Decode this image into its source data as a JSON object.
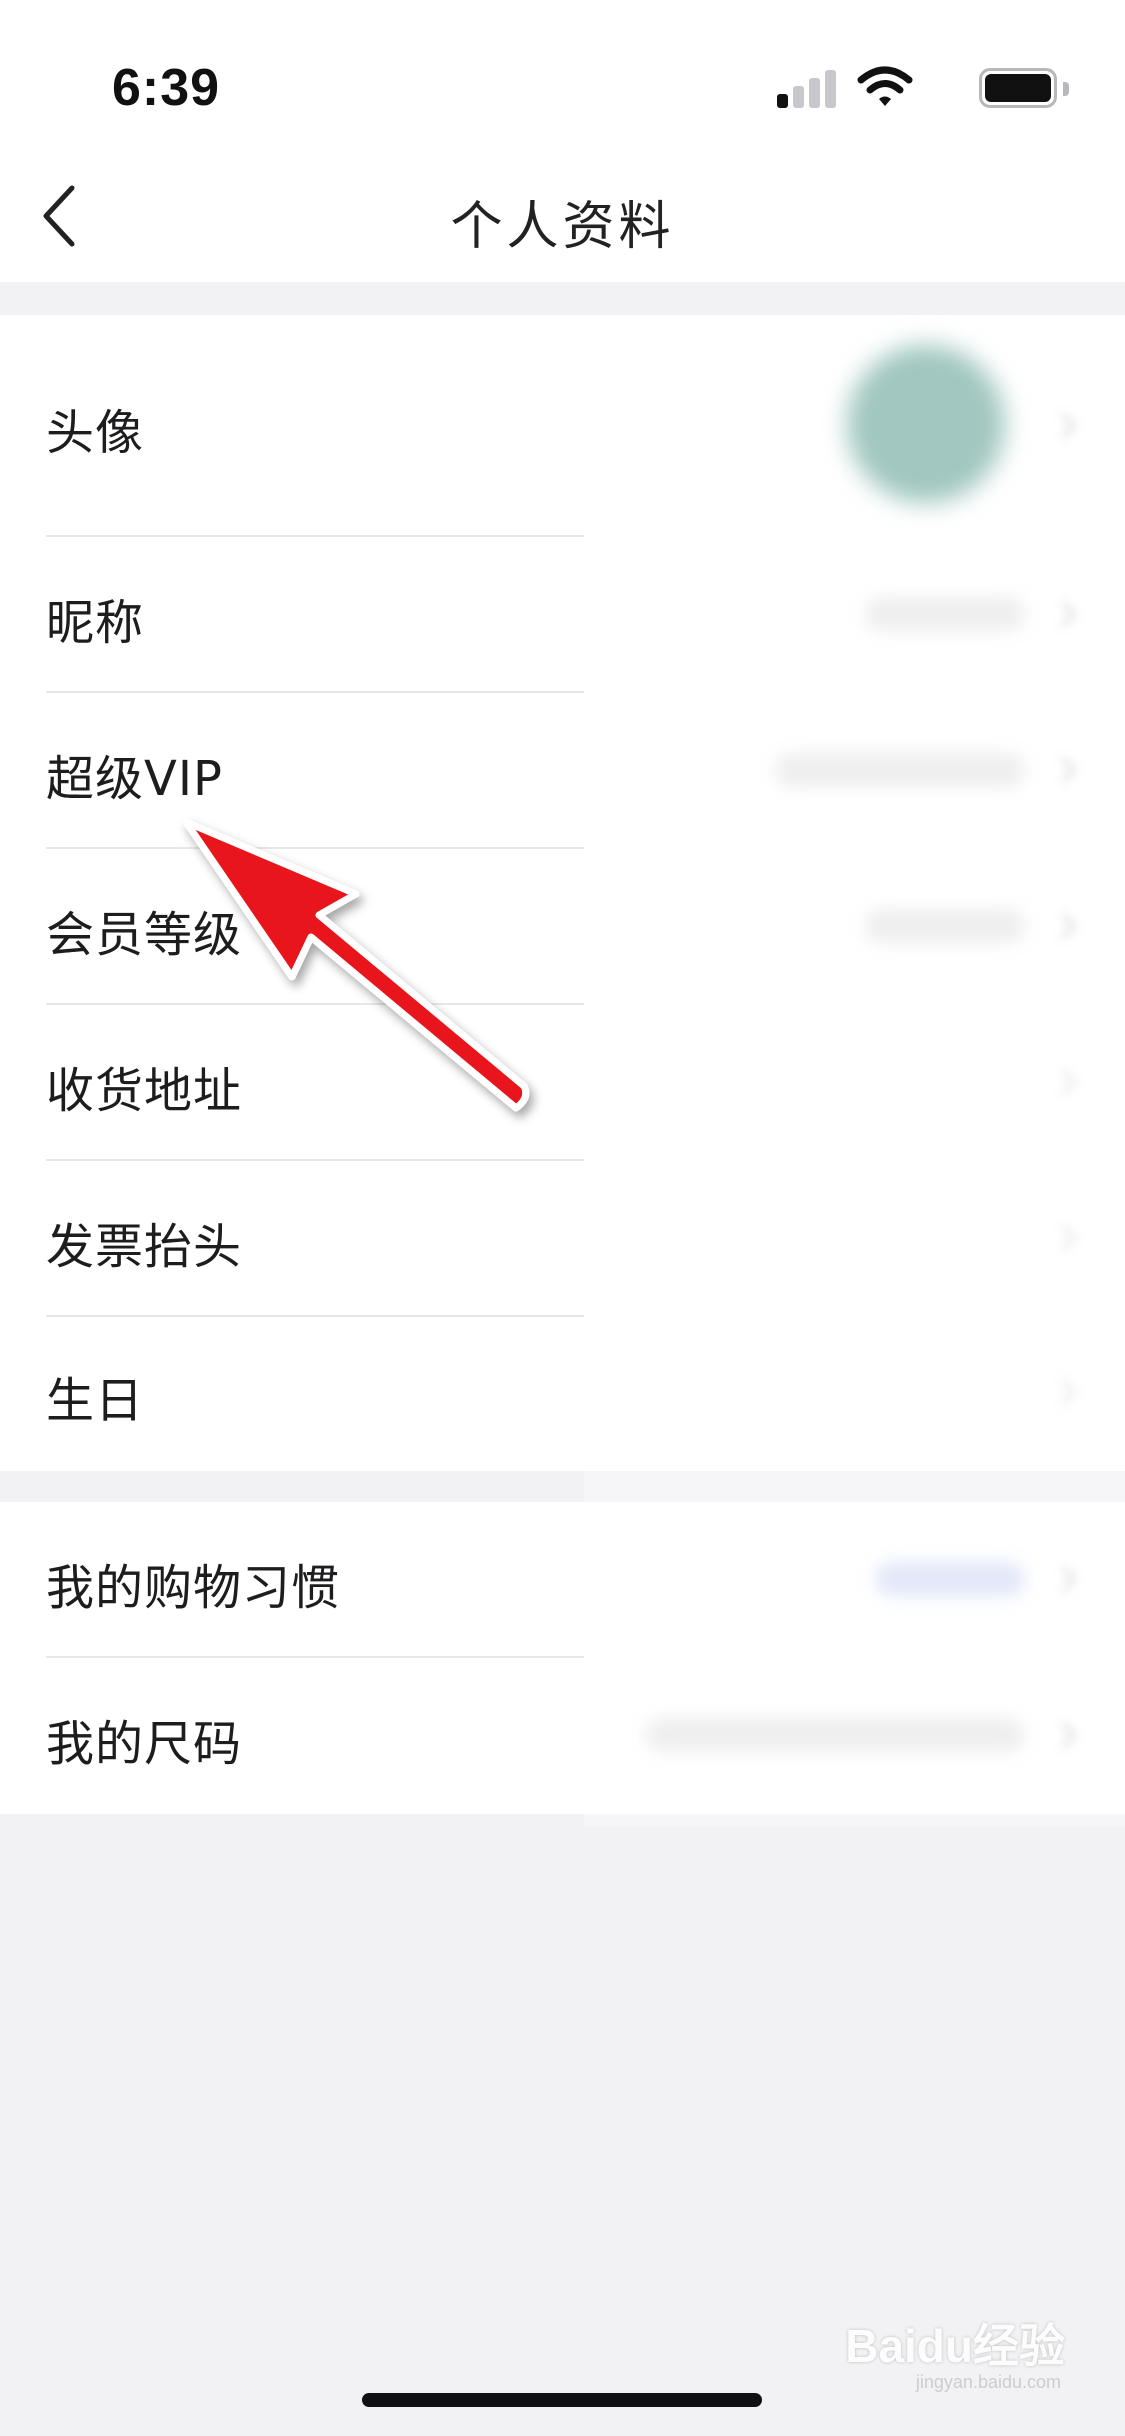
{
  "status_bar": {
    "time": "6:39",
    "signal_bars": 4,
    "signal_bars_active": 1
  },
  "nav": {
    "back_icon": "chevron-left-icon",
    "title": "个人资料"
  },
  "groups": [
    {
      "items": [
        {
          "label": "头像",
          "type": "avatar"
        },
        {
          "label": "昵称"
        },
        {
          "label": "超级VIP"
        },
        {
          "label": "会员等级"
        },
        {
          "label": "收货地址"
        },
        {
          "label": "发票抬头"
        },
        {
          "label": "生日"
        }
      ]
    },
    {
      "items": [
        {
          "label": "我的购物习惯"
        },
        {
          "label": "我的尺码"
        }
      ]
    }
  ],
  "colors": {
    "annotation_arrow": "#e8141c",
    "avatar": "#6fa99e",
    "background": "#f2f2f4"
  },
  "watermark": {
    "brand": "Baidu经验",
    "url": "jingyan.baidu.com"
  }
}
